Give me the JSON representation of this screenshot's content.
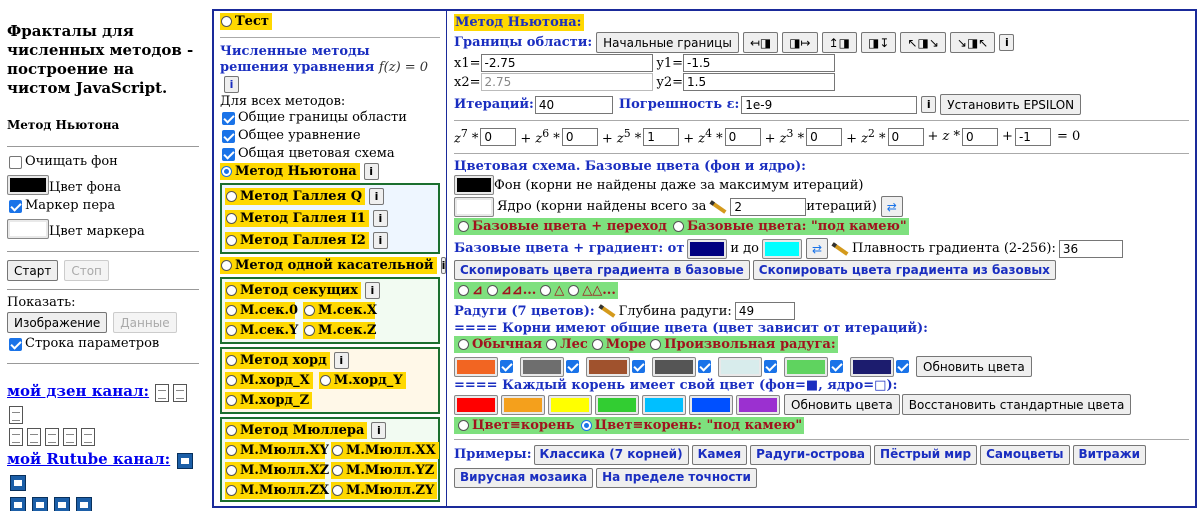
{
  "left": {
    "title": "Фракталы для численных методов - построение на чистом JavaScript.",
    "method": "Метод Ньютона",
    "clear_bg": "Очищать фон",
    "bg_color_label": "Цвет фона",
    "pen_marker": "Маркер пера",
    "marker_color_label": "Цвет маркера",
    "start": "Старт",
    "stop": "Стоп",
    "show": "Показать:",
    "image": "Изображение",
    "data": "Данные",
    "params_row": "Строка параметров",
    "dzen": "мой дзен канал:",
    "rutube": "мой Rutube канал:",
    "colors": {
      "bg": "#000000",
      "marker": "#ffffff"
    }
  },
  "mid": {
    "test": "Тест",
    "section": "Численные методы решения уравнения",
    "eq": "f(z) = 0",
    "all_methods": "Для всех методов:",
    "common_bounds": "Общие границы области",
    "common_eq": "Общее уравнение",
    "common_colors": "Общая цветовая схема",
    "newton": "Метод Ньютона",
    "halley_q": "Метод Галлея Q",
    "halley_i1": "Метод Галлея I1",
    "halley_i2": "Метод Галлея I2",
    "one_tangent": "Метод одной касательной",
    "secants": "Метод секущих",
    "sec0": "М.сек.0",
    "secx": "М.сек.X",
    "secy": "М.сек.Y",
    "secz": "М.сек.Z",
    "chords": "Метод хорд",
    "chx": "М.хорд_X",
    "chy": "М.хорд_Y",
    "chz": "М.хорд_Z",
    "muller": "Метод Мюллера",
    "mxy": "М.Мюлл.XY",
    "mxx": "М.Мюлл.XX",
    "mxz": "М.Мюлл.XZ",
    "myz": "М.Мюлл.YZ",
    "mzx": "М.Мюлл.ZX",
    "mzy": "М.Мюлл.ZY",
    "info": "i"
  },
  "right": {
    "title": "Метод Ньютона:",
    "bounds": "Границы области:",
    "initial_bounds": "Начальные границы",
    "nav": [
      "↤◨",
      "◨↦",
      "↥◨",
      "◨↧",
      "↖◨↘",
      "↘◨↖"
    ],
    "x1_label": "x1=",
    "x1": "-2.75",
    "y1_label": "y1=",
    "y1": "-1.5",
    "x2_label": "x2=",
    "x2": "2.75",
    "y2_label": "y2=",
    "y2": "1.5",
    "iter_label": "Итераций:",
    "iter": "40",
    "eps_label": "Погрешность ε:",
    "eps": "1e-9",
    "set_eps": "Установить EPSILON",
    "poly": {
      "c7": "0",
      "c6": "0",
      "c5": "1",
      "c4": "0",
      "c3": "0",
      "c2": "0",
      "c1": "0",
      "c0": "-1",
      "rhs": "= 0"
    },
    "scheme_title": "Цветовая схема. Базовые цвета (фон и ядро):",
    "bg_desc": "Фон (корни не найдены даже за максимум итераций)",
    "core_desc": "Ядро (корни найдены всего за",
    "core_iter": "2",
    "core_suffix": "итераций)",
    "base_trans": "Базовые цвета + переход",
    "base_camo": "Базовые цвета: \"под камею\"",
    "grad_label": "Базовые цвета + градиент: от",
    "grad_to": "и до",
    "smooth_label": "Плавность градиента (2-256):",
    "smooth": "36",
    "copy_to_base": "Скопировать цвета градиента в базовые",
    "copy_from_base": "Скопировать цвета градиента из базовых",
    "shapes": [
      "⊿",
      "⊿⊿...",
      "△",
      "△△..."
    ],
    "rainbow_label": "Радуги (7 цветов):",
    "depth_label": "Глубина радуги:",
    "depth": "49",
    "roots_common": "==== Корни имеют общие цвета (цвет зависит от итераций):",
    "ordinary": "Обычная",
    "forest": "Лес",
    "sea": "Море",
    "arbitrary": "Произвольная радуга:",
    "update_colors": "Обновить цвета",
    "each_root": "==== Каждый корень имеет свой цвет (фон=■, ядро=□):",
    "update_color": "Обновить цвета",
    "restore": "Восстановить стандартные цвета",
    "color_root": "Цвет≡корень",
    "color_root_camo": "Цвет≡корень: \"под камею\"",
    "examples_label": "Примеры:",
    "examples": [
      "Классика (7 корней)",
      "Камея",
      "Радуги-острова",
      "Пёстрый мир",
      "Самоцветы",
      "Витражи",
      "Вирусная мозаика",
      "На пределе точности"
    ],
    "colors": {
      "bg": "#000000",
      "core": "#ffffff",
      "grad_from": "#000080",
      "grad_to": "#00ffff",
      "rainbow": [
        "#f26522",
        "#6e6e6e",
        "#a0522d",
        "#555555",
        "#d8ecec",
        "#5fd35f",
        "#1c1c6e"
      ],
      "roots": [
        "#ff0000",
        "#f4a01c",
        "#ffff00",
        "#32cd32",
        "#00bfff",
        "#0050ff",
        "#9b30d0"
      ]
    }
  }
}
